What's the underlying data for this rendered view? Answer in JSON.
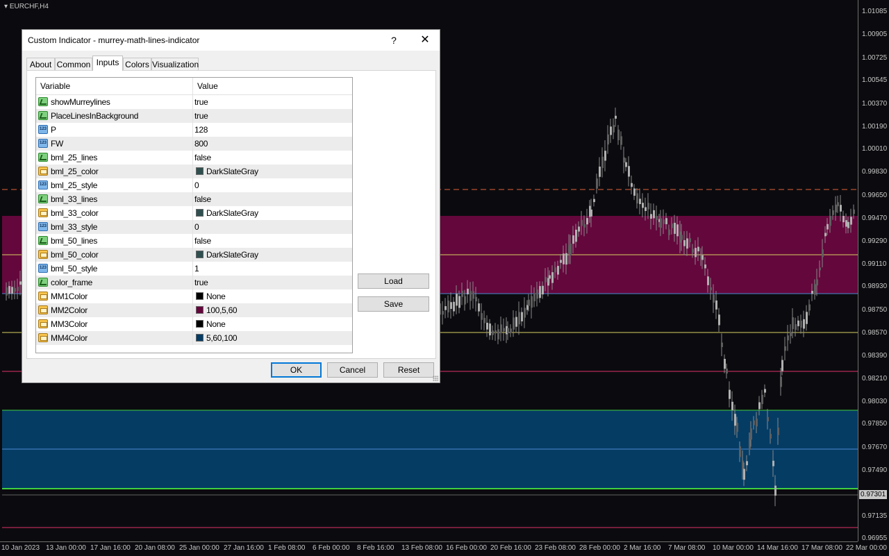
{
  "chart": {
    "symbol": "EURCHF,H4",
    "current_price": "0.97301",
    "price_ticks": [
      "1.01085",
      "1.00905",
      "1.00725",
      "1.00545",
      "1.00370",
      "1.00190",
      "1.00010",
      "0.99830",
      "0.99650",
      "0.99470",
      "0.99290",
      "0.99110",
      "0.98930",
      "0.98750",
      "0.98570",
      "0.98390",
      "0.98210",
      "0.98030",
      "0.97850",
      "0.97670",
      "0.97490",
      "0.97135",
      "0.96955"
    ],
    "time_ticks": [
      "10 Jan 2023",
      "13 Jan 00:00",
      "17 Jan 16:00",
      "20 Jan 08:00",
      "25 Jan 00:00",
      "27 Jan 16:00",
      "1 Feb 08:00",
      "6 Feb 00:00",
      "8 Feb 16:00",
      "13 Feb 08:00",
      "16 Feb 00:00",
      "20 Feb 16:00",
      "23 Feb 08:00",
      "28 Feb 00:00",
      "2 Mar 16:00",
      "7 Mar 08:00",
      "10 Mar 00:00",
      "14 Mar 16:00",
      "17 Mar 08:00",
      "22 Mar 00:00"
    ],
    "colors": {
      "background": "#0b0b0f",
      "band_upper": "#64073c",
      "band_lower": "#053c64",
      "candle": "#8a8a8a",
      "dashed_line": "#e0603a",
      "yellow_line": "#d8d060",
      "pink_line": "#e0306a",
      "green_line": "#40d040",
      "blue_line": "#4a8ad0"
    }
  },
  "dialog": {
    "title": "Custom Indicator - murrey-math-lines-indicator",
    "help_glyph": "?",
    "close_glyph": "✕",
    "tabs": [
      {
        "label": "About"
      },
      {
        "label": "Common"
      },
      {
        "label": "Inputs"
      },
      {
        "label": "Colors"
      },
      {
        "label": "Visualization"
      }
    ],
    "active_tab": "Inputs",
    "grid": {
      "header_variable": "Variable",
      "header_value": "Value",
      "rows": [
        {
          "var": "showMurreylines",
          "value": "true",
          "type": "bool"
        },
        {
          "var": "PlaceLinesInBackground",
          "value": "true",
          "type": "bool"
        },
        {
          "var": "P",
          "value": "128",
          "type": "num"
        },
        {
          "var": "FW",
          "value": "800",
          "type": "num"
        },
        {
          "var": "bml_25_lines",
          "value": "false",
          "type": "bool"
        },
        {
          "var": "bml_25_color",
          "value": "DarkSlateGray",
          "type": "color",
          "swatch": "#2f4f4f"
        },
        {
          "var": "bml_25_style",
          "value": "0",
          "type": "num"
        },
        {
          "var": "bml_33_lines",
          "value": "false",
          "type": "bool"
        },
        {
          "var": "bml_33_color",
          "value": "DarkSlateGray",
          "type": "color",
          "swatch": "#2f4f4f"
        },
        {
          "var": "bml_33_style",
          "value": "0",
          "type": "num"
        },
        {
          "var": "bml_50_lines",
          "value": "false",
          "type": "bool"
        },
        {
          "var": "bml_50_color",
          "value": "DarkSlateGray",
          "type": "color",
          "swatch": "#2f4f4f"
        },
        {
          "var": "bml_50_style",
          "value": "1",
          "type": "num"
        },
        {
          "var": "color_frame",
          "value": "true",
          "type": "bool"
        },
        {
          "var": "MM1Color",
          "value": "None",
          "type": "color",
          "swatch": "#000000"
        },
        {
          "var": "MM2Color",
          "value": "100,5,60",
          "type": "color",
          "swatch": "#64053c"
        },
        {
          "var": "MM3Color",
          "value": "None",
          "type": "color",
          "swatch": "#000000"
        },
        {
          "var": "MM4Color",
          "value": "5,60,100",
          "type": "color",
          "swatch": "#053c64"
        }
      ]
    },
    "buttons": {
      "load": "Load",
      "save": "Save",
      "ok": "OK",
      "cancel": "Cancel",
      "reset": "Reset"
    },
    "icon_num_text": "123"
  }
}
